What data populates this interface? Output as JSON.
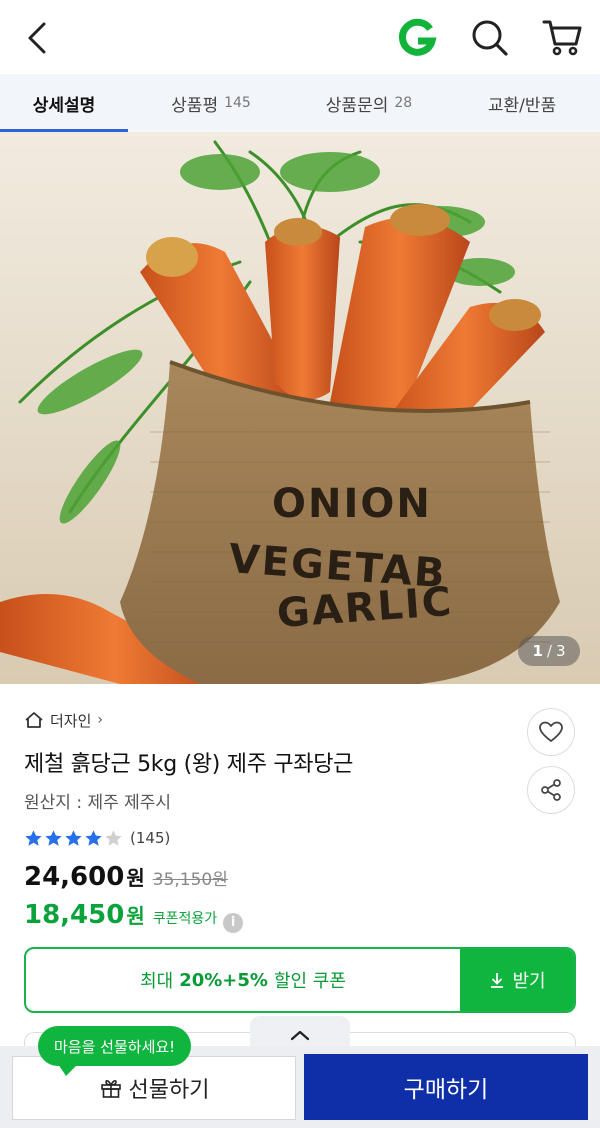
{
  "header": {
    "back_icon": "back-arrow-icon",
    "logo_icon": "g-logo-icon",
    "logo_color": "#12b33a",
    "search_icon": "search-icon",
    "cart_icon": "cart-icon"
  },
  "tabs": [
    {
      "label": "상세설명",
      "count": "",
      "active": true
    },
    {
      "label": "상품평",
      "count": "145",
      "active": false
    },
    {
      "label": "상품문의",
      "count": "28",
      "active": false
    },
    {
      "label": "교환/반품",
      "count": "",
      "active": false
    }
  ],
  "image": {
    "bag_text_lines": [
      "ONION",
      "VEGETAB",
      "GARLIC"
    ],
    "counter_current": "1",
    "counter_separator": "/",
    "counter_total": "3"
  },
  "product": {
    "shop_name": "더자인",
    "shop_chevron": "›",
    "title": "제철 흙당근 5kg (왕) 제주 구좌당근",
    "origin": "원산지 : 제주 제주시",
    "rating_stars": 4,
    "rating_max": 5,
    "review_count": "(145)",
    "price": "24,600",
    "price_unit": "원",
    "original_price": "35,150원",
    "coupon_price": "18,450",
    "coupon_price_unit": "원",
    "coupon_label": "쿠폰적용가",
    "info_icon_glyph": "i"
  },
  "coupon": {
    "text_before": "최대",
    "text_em": "20%+5%",
    "text_after": "할인 쿠폰",
    "get_label": "받기"
  },
  "bottom": {
    "gift_bubble": "마음을 선물하세요!",
    "gift_label": "선물하기",
    "buy_label": "구매하기"
  },
  "colors": {
    "accent_blue": "#2a64d6",
    "green": "#10b53f",
    "buy_blue": "#0f2fa8",
    "star_blue": "#2670e8"
  }
}
